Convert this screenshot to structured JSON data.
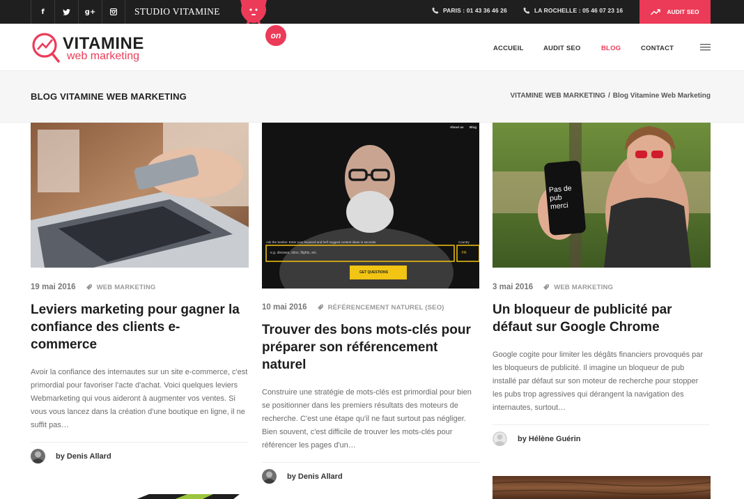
{
  "topbar": {
    "social": [
      "f",
      "t",
      "g+",
      "instagram"
    ],
    "studio": "STUDIO VITAMINE",
    "phones": [
      {
        "label": "PARIS : 01 43 36 46 26"
      },
      {
        "label": "LA ROCHELLE : 05 46 07 23 16"
      }
    ],
    "audit_label": "AUDIT SEO"
  },
  "header": {
    "logo_word": "VITAMINE",
    "logo_sub": "web marketing",
    "badge": "on",
    "nav": [
      "ACCUEIL",
      "AUDIT SEO",
      "BLOG",
      "CONTACT"
    ]
  },
  "titleband": {
    "title": "BLOG VITAMINE WEB MARKETING",
    "crumb_home": "VITAMINE WEB MARKETING",
    "crumb_sep": "/",
    "crumb_current": "Blog Vitamine Web Marketing"
  },
  "posts": [
    {
      "date": "19 mai 2016",
      "category": "WEB MARKETING",
      "title": "Leviers marketing pour gagner la confiance des clients e-commerce",
      "excerpt": "Avoir la confiance des internautes sur un site e-commerce, c'est primordial pour favoriser l'acte d'achat. Voici quelques leviers Webmarketing qui vous aideront à augmenter vos ventes. Si vous vous lancez dans la création d'une boutique en ligne, il ne suffit pas…",
      "author": "by Denis Allard"
    },
    {
      "date": "10 mai 2016",
      "category": "RÉFÉRENCEMENT NATUREL (SEO)",
      "title": "Trouver des bons mots-clés pour préparer son référencement naturel",
      "excerpt": "Construire une stratégie de mots-clés est primordial pour bien se positionner dans les premiers résultats des moteurs de recherche. C'est une étape qu'il ne faut surtout pas négliger. Bien souvent, c'est difficile de trouver les mots-clés pour référencer les pages d'un…",
      "author": "by Denis Allard",
      "image_texts": {
        "nav": [
          "About us",
          "Blog"
        ],
        "prompt": "Ask the Seeker. Enter your keyword and he'll suggest content ideas in seconds.",
        "country_label": "Country",
        "placeholder": "e.g. dresses, xbox, flights, etc.",
        "country": "FR",
        "button": "GET QUESTIONS"
      }
    },
    {
      "date": "3 mai 2016",
      "category": "WEB MARKETING",
      "title": "Un bloqueur de publicité par défaut sur Google Chrome",
      "excerpt": "Google cogite pour limiter les dégâts financiers provoqués par les bloqueurs de publicité. Il imagine un bloqueur de pub installé par défaut sur son moteur de recherche pour stopper les pubs trop agressives qui dérangent la navigation des internautes, surtout…",
      "author": "by Hélène Guérin",
      "image_texts": {
        "phone_screen": [
          "Pas de",
          "pub",
          "merci"
        ]
      }
    }
  ],
  "colors": {
    "accent": "#ec3b58",
    "topbar": "#1f1f1f",
    "band": "#f6f6f6"
  },
  "icons": [
    "facebook-icon",
    "twitter-icon",
    "google-plus-icon",
    "instagram-icon",
    "phone-icon",
    "trend-icon",
    "tag-icon",
    "menu-icon"
  ]
}
